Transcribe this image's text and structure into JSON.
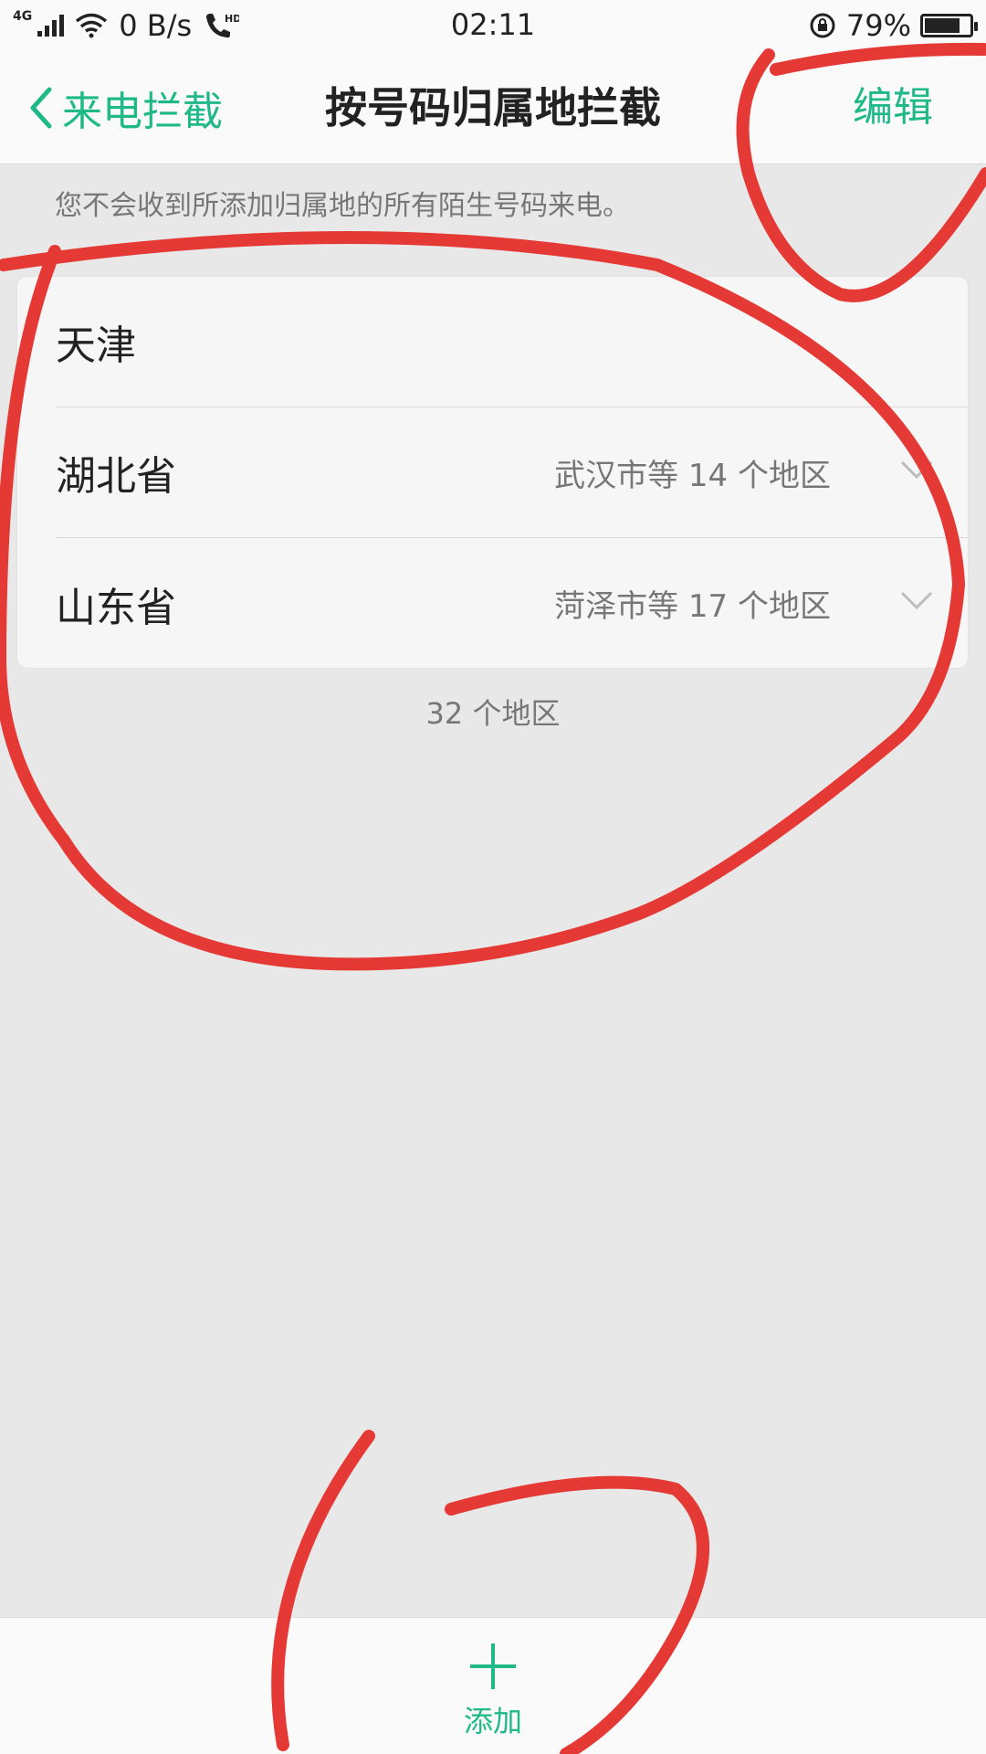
{
  "status_bar": {
    "network": "4G",
    "speed": "0 B/s",
    "call_icon": "hd-call-icon",
    "time": "02:11",
    "battery": "79%",
    "battery_level": 0.79
  },
  "header": {
    "back_label": "来电拦截",
    "title": "按号码归属地拦截",
    "edit_label": "编辑"
  },
  "hint": "您不会收到所添加归属地的所有陌生号码来电。",
  "regions": [
    {
      "name": "天津",
      "sub": ""
    },
    {
      "name": "湖北省",
      "sub": "武汉市等 14 个地区"
    },
    {
      "name": "山东省",
      "sub": "菏泽市等 17 个地区"
    }
  ],
  "count": "32 个地区",
  "bottom": {
    "add_label": "添加"
  },
  "colors": {
    "accent": "#1fb987",
    "annotation": "#e53935"
  }
}
